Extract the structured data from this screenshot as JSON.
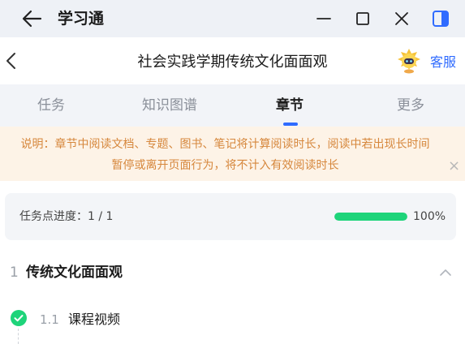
{
  "window": {
    "app_title": "学习通",
    "icons": [
      "back-arrow-icon",
      "minimize-icon",
      "maximize-icon",
      "close-icon",
      "sidebar-toggle-icon"
    ]
  },
  "header": {
    "title": "社会实践学期传统文化面面观",
    "service_label": "客服"
  },
  "tabs": [
    {
      "label": "任务",
      "active": false
    },
    {
      "label": "知识图谱",
      "active": false
    },
    {
      "label": "章节",
      "active": true
    },
    {
      "label": "更多",
      "active": false
    }
  ],
  "notice": {
    "line1": "说明：章节中阅读文档、专题、图书、笔记将计算阅读时长，阅读中若出现长时间",
    "line2": "暂停或离开页面行为，将不计入有效阅读时长",
    "close_glyph": "×"
  },
  "progress": {
    "label": "任务点进度：1 / 1",
    "fraction": 1.0,
    "percent_text": "100%"
  },
  "chapter": {
    "number": "1",
    "title": "传统文化面面观",
    "expanded": true
  },
  "section": {
    "number": "1.1",
    "title": "课程视频",
    "completed": true
  },
  "colors": {
    "accent": "#2f6bff",
    "progress_fill": "#1ed47a",
    "notice_text": "#d6873c",
    "notice_bg": "#fdf3e7"
  }
}
